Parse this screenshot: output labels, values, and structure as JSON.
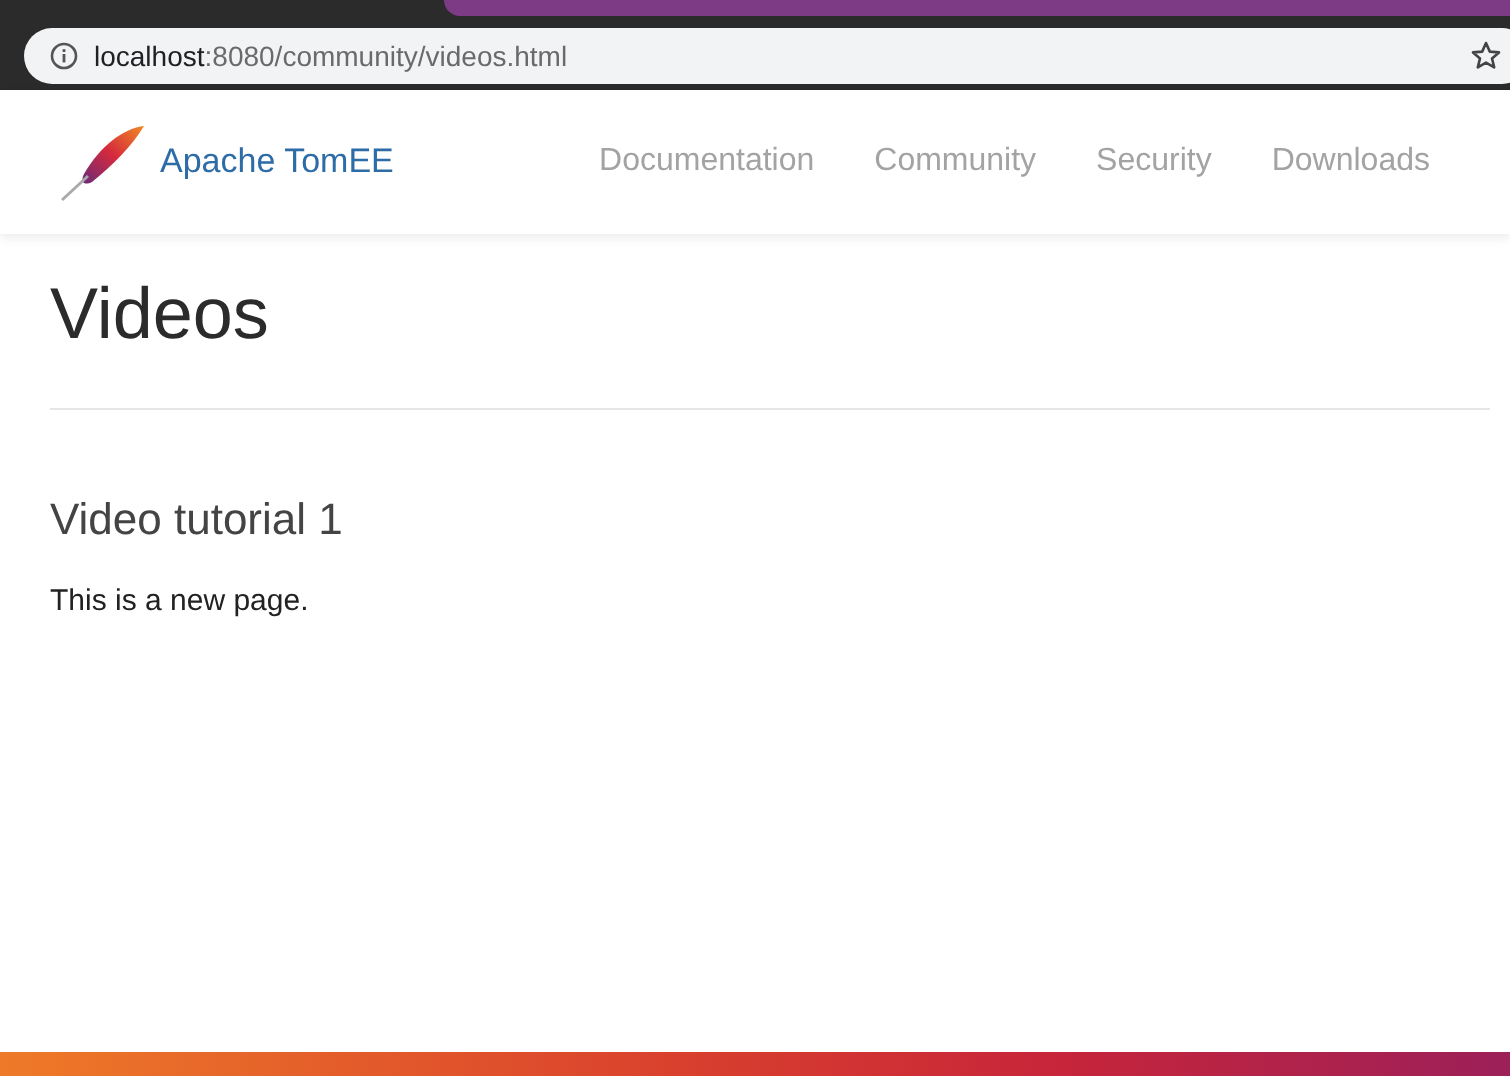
{
  "browser": {
    "url_host": "localhost",
    "url_path": ":8080/community/videos.html"
  },
  "navbar": {
    "brand": "Apache TomEE",
    "links": [
      {
        "label": "Documentation"
      },
      {
        "label": "Community"
      },
      {
        "label": "Security"
      },
      {
        "label": "Downloads"
      }
    ]
  },
  "page": {
    "title": "Videos",
    "section_heading": "Video tutorial 1",
    "paragraph": "This is a new page."
  }
}
